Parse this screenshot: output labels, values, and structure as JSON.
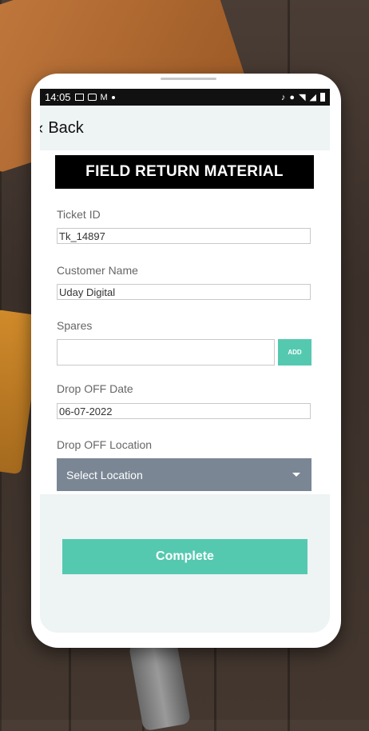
{
  "statusbar": {
    "time": "14:05",
    "left_icons": [
      "image-icon",
      "youtube-icon",
      "gmail-icon"
    ],
    "right_icons": [
      "mute-icon",
      "location-icon",
      "wifi-icon",
      "signal-icon",
      "battery-icon"
    ]
  },
  "header": {
    "back_label": "Back"
  },
  "form": {
    "title": "FIELD RETURN MATERIAL",
    "ticket_id_label": "Ticket ID",
    "ticket_id_value": "Tk_14897",
    "customer_name_label": "Customer Name",
    "customer_name_value": "Uday Digital",
    "spares_label": "Spares",
    "spares_value": "",
    "add_label": "ADD",
    "drop_off_date_label": "Drop OFF Date",
    "drop_off_date_value": "06-07-2022",
    "drop_off_location_label": "Drop OFF Location",
    "drop_off_location_selected": "Select Location"
  },
  "actions": {
    "complete_label": "Complete"
  },
  "colors": {
    "accent": "#55c9b0",
    "select_bg": "#7a8694",
    "title_bg": "#000000",
    "screen_bg": "#eef3f3"
  }
}
